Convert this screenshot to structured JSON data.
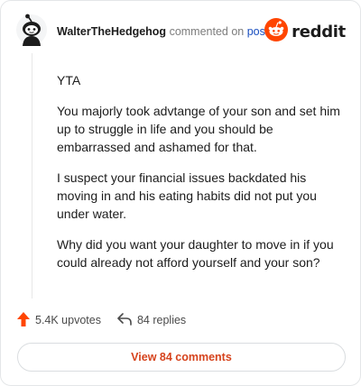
{
  "comment": {
    "username": "WalterTheHedgehog",
    "commented_text": "commented on",
    "post_link": "post",
    "brand": "reddit",
    "paragraphs": [
      "YTA",
      "You majorly took advtange of your son and set him up to struggle in life and you should be embarrassed and ashamed for that.",
      "I suspect your financial issues backdated his moving in and his eating habits did not put you under water.",
      "Why did you want your daughter to move in if you could already not afford yourself and your son?"
    ]
  },
  "stats": {
    "upvotes": "5.4K upvotes",
    "replies": "84 replies"
  },
  "footer": {
    "view_comments": "View 84 comments"
  },
  "colors": {
    "upvote": "#ff4500",
    "link": "#1a4fbf",
    "view_button_text": "#d6431d"
  },
  "icons": {
    "avatar": "snoo-avatar-icon",
    "logo": "reddit-logo-icon",
    "upvote": "upvote-arrow-icon",
    "reply": "reply-arrow-icon"
  }
}
